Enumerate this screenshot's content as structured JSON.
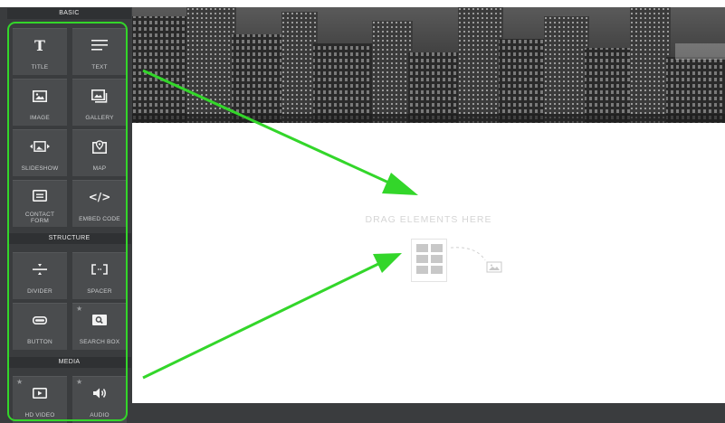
{
  "sidebar": {
    "sections": {
      "basic": "BASIC",
      "structure": "STRUCTURE",
      "media": "MEDIA"
    },
    "basic_items": [
      {
        "label": "TITLE",
        "icon": "title-icon"
      },
      {
        "label": "TEXT",
        "icon": "text-lines-icon"
      },
      {
        "label": "IMAGE",
        "icon": "image-icon"
      },
      {
        "label": "GALLERY",
        "icon": "gallery-icon"
      },
      {
        "label": "SLIDESHOW",
        "icon": "slideshow-icon"
      },
      {
        "label": "MAP",
        "icon": "map-pin-icon"
      },
      {
        "label": "CONTACT",
        "label2": "FORM",
        "icon": "contact-form-icon"
      },
      {
        "label": "EMBED CODE",
        "icon": "code-icon"
      }
    ],
    "structure_items": [
      {
        "label": "DIVIDER",
        "icon": "divider-icon"
      },
      {
        "label": "SPACER",
        "icon": "spacer-icon"
      },
      {
        "label": "BUTTON",
        "icon": "button-icon"
      },
      {
        "label": "SEARCH BOX",
        "icon": "search-icon",
        "premium": true
      }
    ],
    "media_items": [
      {
        "label": "HD VIDEO",
        "icon": "video-icon",
        "premium": true
      },
      {
        "label": "AUDIO",
        "icon": "speaker-icon",
        "premium": true
      }
    ]
  },
  "canvas": {
    "drop_hint": "DRAG ELEMENTS HERE"
  },
  "colors": {
    "sidebar_bg": "#3a3c3e",
    "tile_bg": "#4a4c4e",
    "highlight": "#33d62a"
  }
}
